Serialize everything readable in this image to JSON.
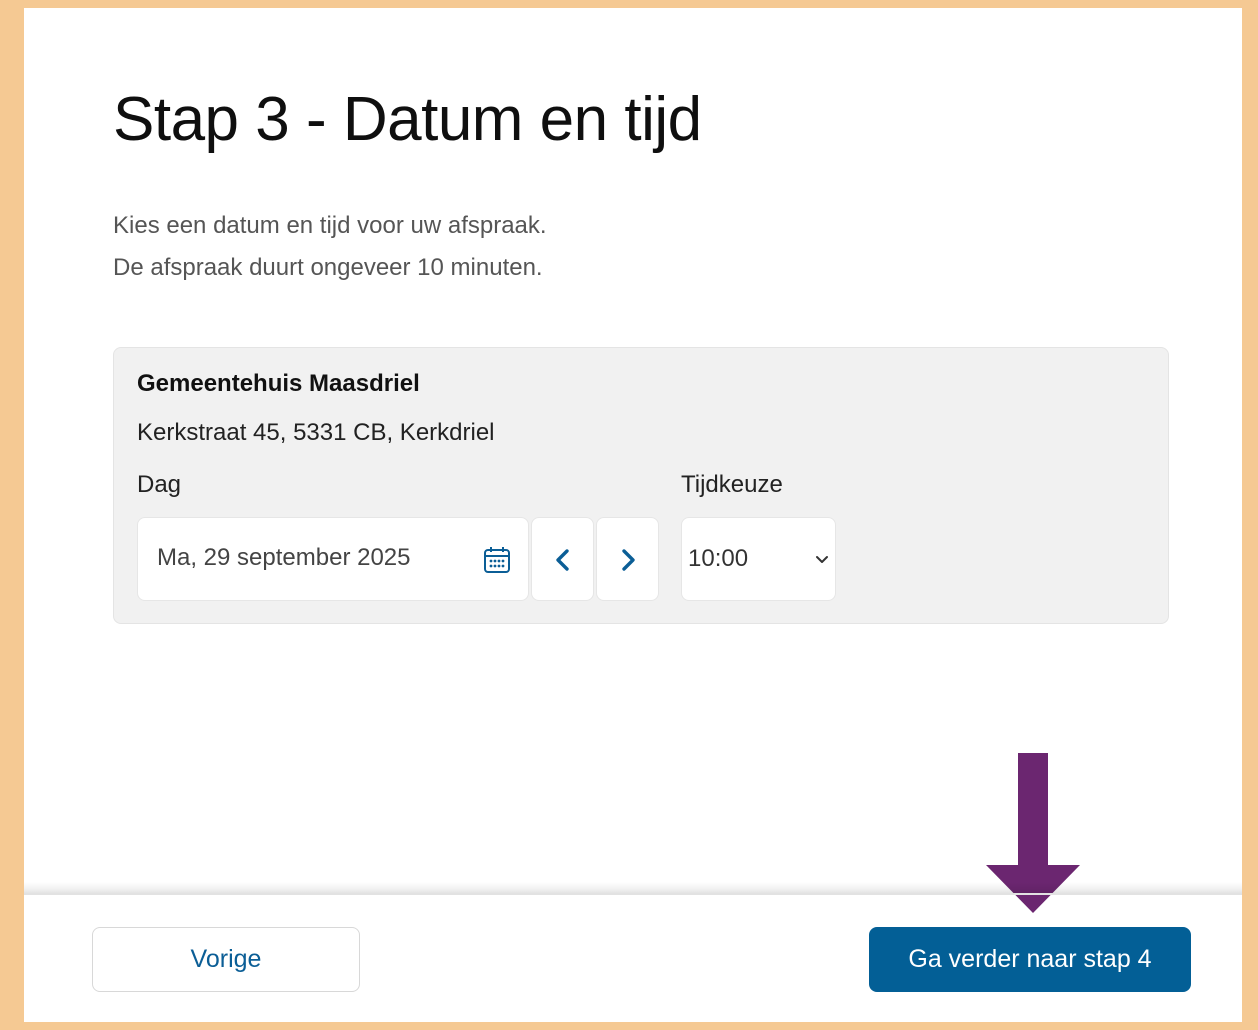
{
  "page": {
    "title": "Stap 3 - Datum en tijd",
    "intro_line1": "Kies een datum en tijd voor uw afspraak.",
    "intro_line2": "De afspraak duurt ongeveer 10 minuten."
  },
  "location": {
    "name": "Gemeentehuis Maasdriel",
    "address": "Kerkstraat 45, 5331 CB, Kerkdriel",
    "day_label": "Dag",
    "time_label": "Tijdkeuze",
    "selected_date": "Ma, 29 september 2025",
    "selected_time": "10:00"
  },
  "footer": {
    "previous_label": "Vorige",
    "next_label": "Ga verder naar stap 4"
  },
  "icons": {
    "calendar": "calendar-icon",
    "prev": "chevron-left-icon",
    "next": "chevron-right-icon",
    "select": "chevron-down-icon",
    "annotation": "arrow-down-icon"
  },
  "colors": {
    "frame": "#f5c993",
    "primary": "#035f96",
    "link": "#0b5e96",
    "annotation_arrow": "#6b2670",
    "card_bg": "#f1f1f1"
  }
}
